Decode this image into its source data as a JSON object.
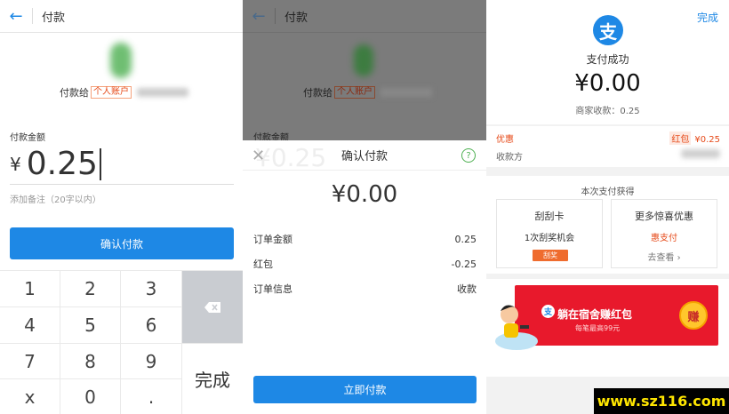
{
  "panel1": {
    "title": "付款",
    "payee_prefix": "付款给",
    "payee_tag": "个人账户",
    "amount_label": "付款金额",
    "currency": "¥",
    "amount": "0.25",
    "remark_placeholder": "添加备注（20字以内）",
    "confirm_label": "确认付款",
    "keys": [
      "1",
      "2",
      "3",
      "4",
      "5",
      "6",
      "7",
      "8",
      "9",
      "x",
      "0",
      "."
    ],
    "done_key": "完成"
  },
  "panel2": {
    "title": "付款",
    "payee_prefix": "付款给",
    "payee_tag": "个人账户",
    "amount_label": "付款金额",
    "ghost_amount": "¥0.25",
    "sheet_title": "确认付款",
    "sheet_amount": "¥0.00",
    "rows": [
      {
        "label": "订单金额",
        "value": "0.25"
      },
      {
        "label": "红包",
        "value": "-0.25"
      },
      {
        "label": "订单信息",
        "value": "收款"
      }
    ],
    "pay_now_label": "立即付款"
  },
  "panel3": {
    "done_label": "完成",
    "logo_char": "支",
    "success_text": "支付成功",
    "amount": "¥0.00",
    "merchant_received": "商家收款：0.25",
    "promo_label": "优惠",
    "hongbao_label": "红包",
    "hongbao_value": "¥0.25",
    "payee_label": "收款方",
    "gain_title": "本次支付获得",
    "cards": [
      {
        "title": "刮刮卡",
        "sub": "1次刮奖机会",
        "chip": "刮奖"
      },
      {
        "title": "更多惊喜优惠",
        "sub": "惠支付",
        "link": "去查看 ›"
      }
    ],
    "ad": {
      "title": "躺在宿舍赚红包",
      "subtitle": "每笔最高99元",
      "coin": "赚"
    }
  },
  "watermark": "www.sz116.com",
  "colors": {
    "accent": "#1e88e5",
    "promo_red": "#e64a19",
    "ad_red": "#e8192c"
  }
}
